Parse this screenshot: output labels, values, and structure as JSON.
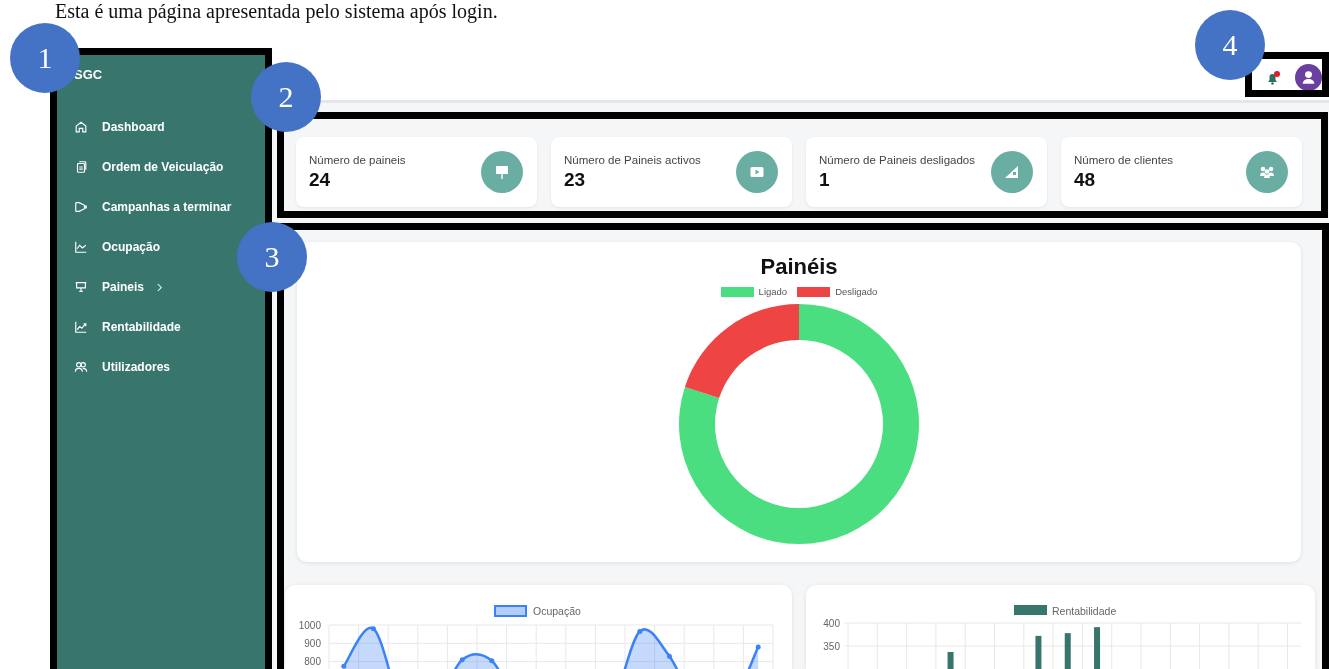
{
  "document_caption": "Esta é uma página apresentada pelo sistema após login.",
  "annotations": [
    "1",
    "2",
    "3",
    "4"
  ],
  "sidebar": {
    "brand": "SGC",
    "items": [
      {
        "label": "Dashboard",
        "has_submenu": false
      },
      {
        "label": "Ordem de Veiculação",
        "has_submenu": false
      },
      {
        "label": "Campanhas a terminar",
        "has_submenu": false
      },
      {
        "label": "Ocupação",
        "has_submenu": false
      },
      {
        "label": "Paineis",
        "has_submenu": true
      },
      {
        "label": "Rentabilidade",
        "has_submenu": false
      },
      {
        "label": "Utilizadores",
        "has_submenu": false
      }
    ]
  },
  "topbar": {
    "notification": true
  },
  "stats": [
    {
      "label": "Número de paineis",
      "value": "24"
    },
    {
      "label": "Número de Paineis activos",
      "value": "23"
    },
    {
      "label": "Número de Paineis desligados",
      "value": "1"
    },
    {
      "label": "Número de clientes",
      "value": "48"
    }
  ],
  "panels_chart": {
    "chart_data": {
      "type": "donut",
      "title": "Painéis",
      "categories": [
        "Ligado",
        "Desligado"
      ],
      "values": [
        80,
        20
      ]
    }
  },
  "occupancy_chart": {
    "chart_data": {
      "type": "area",
      "series": [
        {
          "name": "Ocupação",
          "color": "#3b82f6",
          "values": [
            775,
            980,
            null,
            null,
            810,
            805,
            null,
            null,
            null,
            null,
            965,
            830,
            null,
            null,
            880
          ]
        }
      ],
      "ylim": [
        760,
        1000
      ],
      "grid": true,
      "yticks": [
        800,
        900,
        1000
      ]
    }
  },
  "profitability_chart": {
    "chart_data": {
      "type": "bar",
      "series": [
        {
          "name": "Rentabilidade",
          "color": "#38766d",
          "values": [
            null,
            null,
            null,
            337,
            null,
            null,
            372,
            378,
            391,
            null,
            null,
            null,
            null,
            null,
            null
          ]
        }
      ],
      "ylim": [
        300,
        400
      ],
      "grid": true,
      "yticks": [
        350,
        400
      ]
    }
  }
}
